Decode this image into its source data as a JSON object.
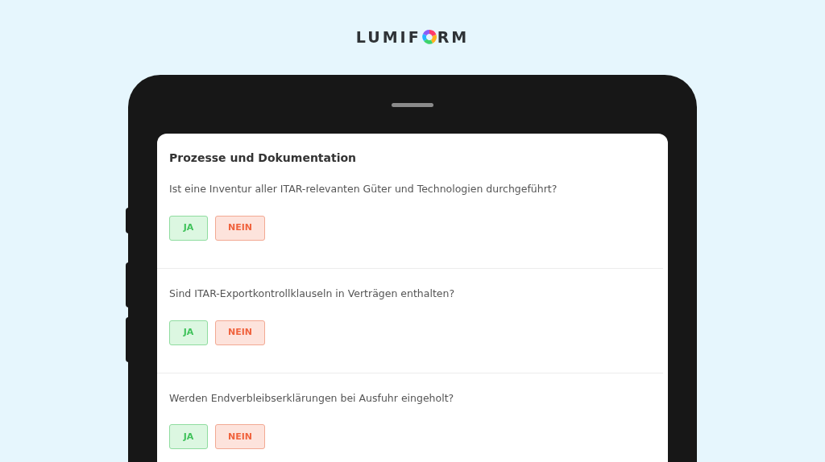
{
  "logo": {
    "before_mark": "LUMIF",
    "after_mark": "RM"
  },
  "form": {
    "title": "Prozesse und Dokumentation",
    "questions": [
      {
        "text": "Ist eine Inventur aller ITAR-relevanten Güter und Technologien durchgeführt?",
        "answers": [
          {
            "label": "JA",
            "kind": "yes"
          },
          {
            "label": "NEIN",
            "kind": "no"
          }
        ]
      },
      {
        "text": "Sind ITAR-Exportkontrollklauseln in Verträgen enthalten?",
        "answers": [
          {
            "label": "JA",
            "kind": "yes"
          },
          {
            "label": "NEIN",
            "kind": "no"
          }
        ]
      },
      {
        "text": "Werden Endverbleibserklärungen bei Ausfuhr eingeholt?",
        "answers": [
          {
            "label": "JA",
            "kind": "yes"
          },
          {
            "label": "NEIN",
            "kind": "no"
          }
        ]
      }
    ]
  }
}
